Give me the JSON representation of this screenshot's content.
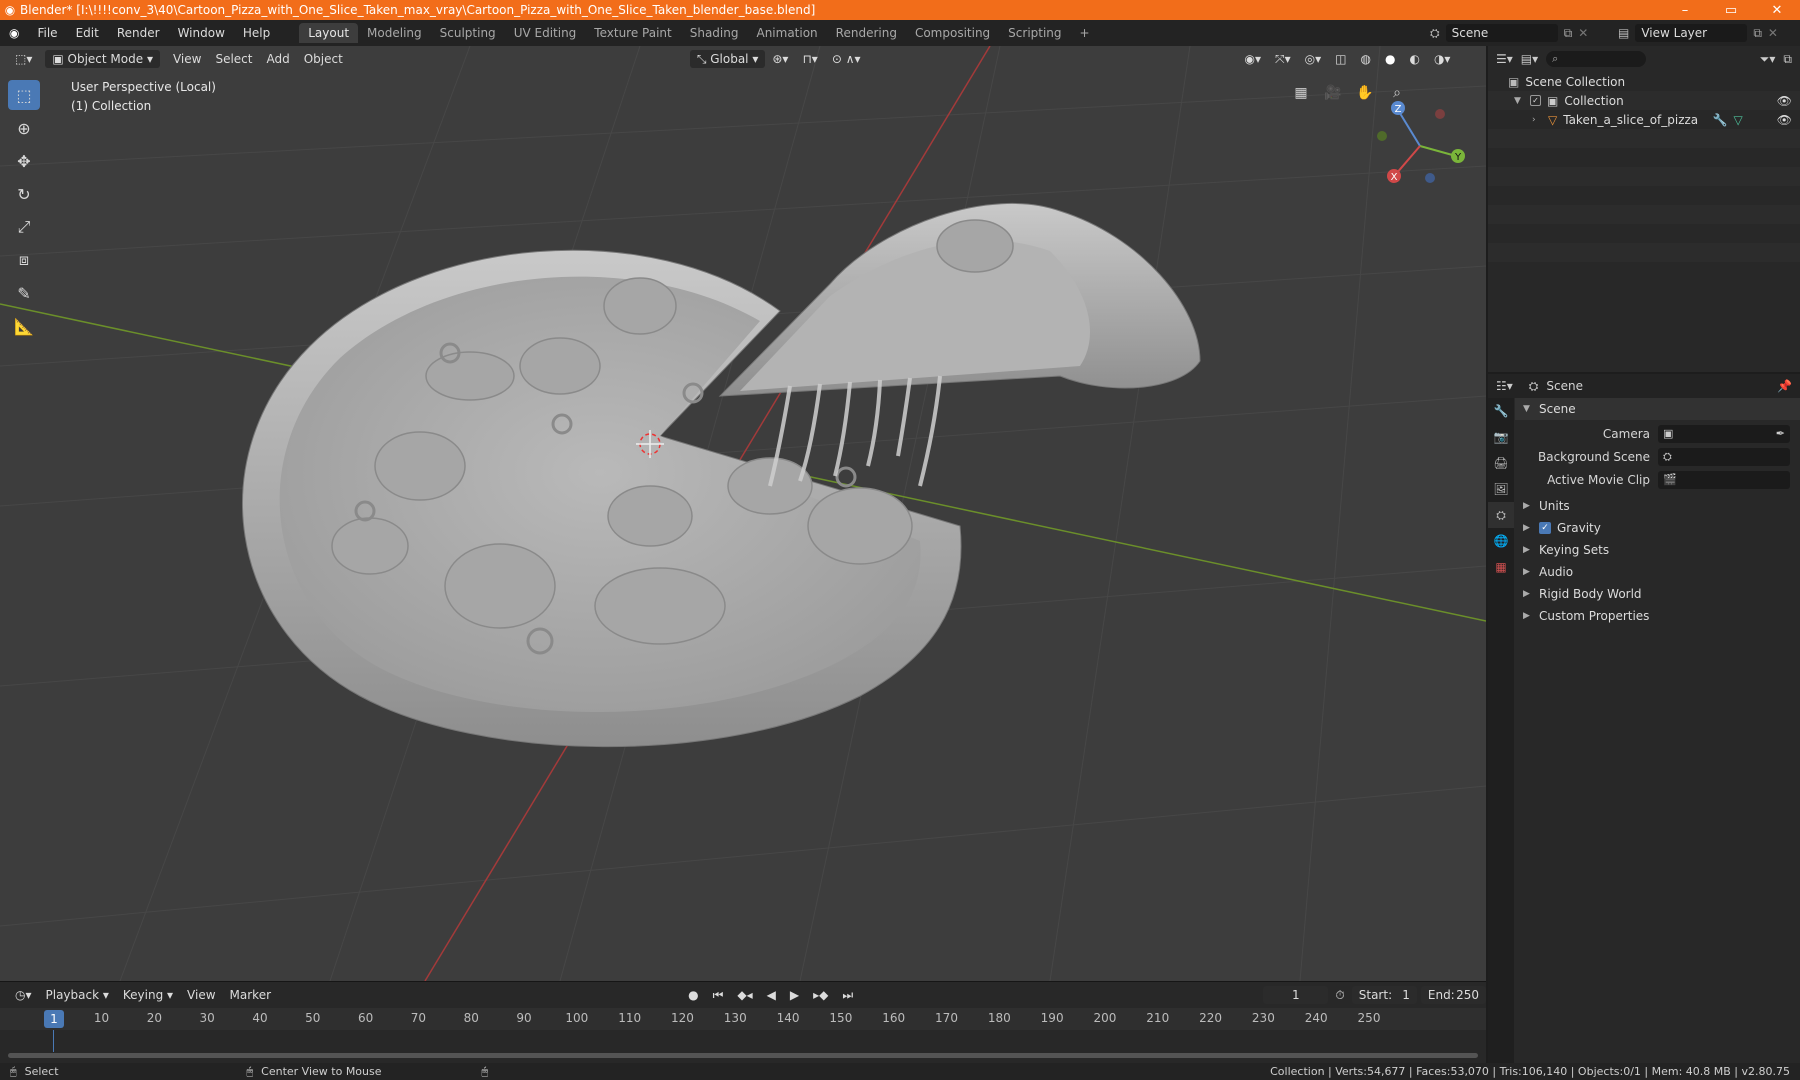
{
  "window": {
    "title": "Blender* [I:\\!!!!conv_3\\40\\Cartoon_Pizza_with_One_Slice_Taken_max_vray\\Cartoon_Pizza_with_One_Slice_Taken_blender_base.blend]",
    "logo": "blender-icon",
    "minimize": "–",
    "maximize": "▭",
    "close": "✕"
  },
  "menu": [
    "File",
    "Edit",
    "Render",
    "Window",
    "Help"
  ],
  "workspaces": [
    "Layout",
    "Modeling",
    "Sculpting",
    "UV Editing",
    "Texture Paint",
    "Shading",
    "Animation",
    "Rendering",
    "Compositing",
    "Scripting",
    "+"
  ],
  "scene_selector": {
    "value": "Scene"
  },
  "layer_selector": {
    "value": "View Layer"
  },
  "viewport": {
    "header": {
      "mode": "Object Mode",
      "menus": [
        "View",
        "Select",
        "Add",
        "Object"
      ],
      "orientation": "Global"
    },
    "info_line1": "User Perspective (Local)",
    "info_line2": "(1) Collection",
    "gizmo": {
      "x": "X",
      "y": "Y",
      "z": "Z"
    }
  },
  "tools": [
    "select-box-icon",
    "cursor-icon",
    "move-icon",
    "rotate-icon",
    "scale-icon",
    "transform-icon",
    "annotate-icon",
    "measure-icon"
  ],
  "outliner": {
    "rows": [
      {
        "label": "Scene Collection"
      },
      {
        "label": "Collection"
      },
      {
        "label": "Taken_a_slice_of_pizza"
      }
    ]
  },
  "properties": {
    "header_title": "Scene",
    "section_scene": "Scene",
    "camera_label": "Camera",
    "background_label": "Background Scene",
    "movieclip_label": "Active Movie Clip",
    "sections": [
      "Units",
      "Gravity",
      "Keying Sets",
      "Audio",
      "Rigid Body World",
      "Custom Properties"
    ]
  },
  "timeline": {
    "menus": [
      "Playback",
      "Keying",
      "View",
      "Marker"
    ],
    "current_frame": "1",
    "start_label": "Start:",
    "start": "1",
    "end_label": "End:",
    "end": "250",
    "ticks": [
      "10",
      "20",
      "30",
      "40",
      "50",
      "60",
      "70",
      "80",
      "90",
      "100",
      "110",
      "120",
      "130",
      "140",
      "150",
      "160",
      "170",
      "180",
      "190",
      "200",
      "210",
      "220",
      "230",
      "240",
      "250"
    ]
  },
  "status": {
    "left": "Select",
    "middle": "Center View to Mouse",
    "right": "Collection | Verts:54,677 | Faces:53,070 | Tris:106,140 | Objects:0/1 | Mem: 40.8 MB | v2.80.75"
  }
}
